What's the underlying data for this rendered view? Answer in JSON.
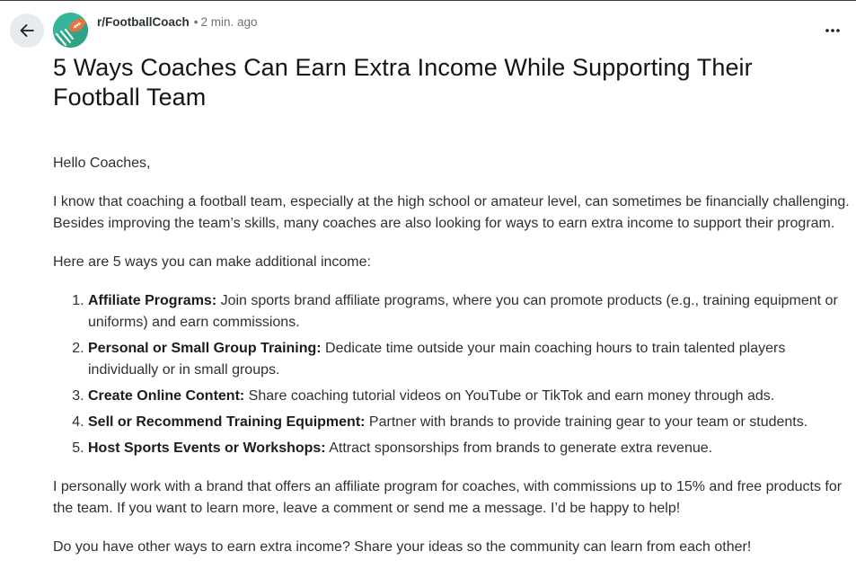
{
  "header": {
    "subreddit": "r/FootballCoach",
    "separator": "•",
    "time_ago": "2 min. ago"
  },
  "post": {
    "title": "5 Ways Coaches Can Earn Extra Income While Supporting Their Football Team",
    "greeting": "Hello Coaches,",
    "intro": "I know that coaching a football team, especially at the high school or amateur level, can sometimes be financially challenging. Besides improving the team’s skills, many coaches are also looking for ways to earn extra income to support their program.",
    "list_intro": "Here are 5 ways you can make additional income:",
    "items": [
      {
        "heading": "Affiliate Programs:",
        "text": " Join sports brand affiliate programs, where you can promote products (e.g., training equipment or uniforms) and earn commissions."
      },
      {
        "heading": "Personal or Small Group Training:",
        "text": " Dedicate time outside your main coaching hours to train talented players individually or in small groups."
      },
      {
        "heading": "Create Online Content:",
        "text": " Share coaching tutorial videos on YouTube or TikTok and earn money through ads."
      },
      {
        "heading": "Sell or Recommend Training Equipment:",
        "text": " Partner with brands to provide training gear to your team or students."
      },
      {
        "heading": "Host Sports Events or Workshops:",
        "text": " Attract sponsorships from brands to generate extra revenue."
      }
    ],
    "closing": "I personally work with a brand that offers an affiliate program for coaches, with commissions up to 15% and free products for the team. If you want to learn more, leave a comment or send me a message. I’d be happy to help!",
    "question": "Do you have other ways to earn extra income? Share your ideas so the community can learn from each other!"
  },
  "icons": {
    "back": "arrow-left-icon",
    "more": "more-horizontal-icon",
    "avatar": "football-avatar-icon"
  },
  "colors": {
    "avatar_bg": "#36b59a",
    "back_button_bg": "#e5ebee",
    "text": "#2a3236",
    "meta": "#6a7479"
  }
}
